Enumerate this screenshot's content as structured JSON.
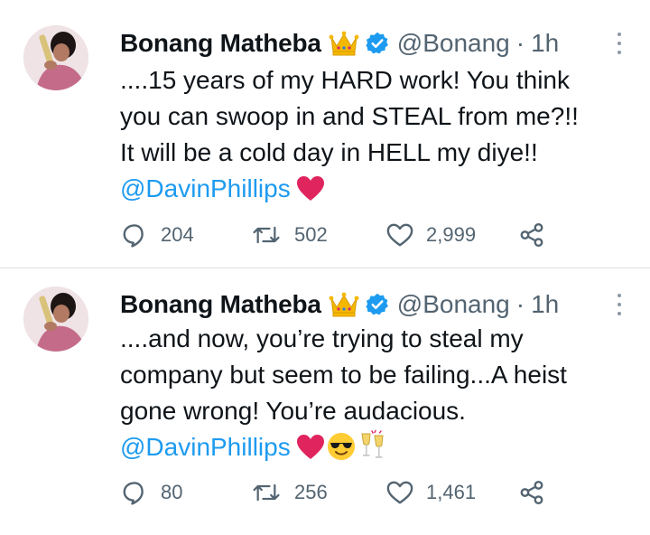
{
  "tweets": [
    {
      "author_name": "Bonang Matheba",
      "handle": "@Bonang",
      "separator": "·",
      "time": "1h",
      "text_lines": [
        "....15 years of my HARD work! You think",
        "you can swoop in and STEAL from me?!!",
        "It will be a cold day in HELL my diye!!"
      ],
      "mention": "@DavinPhillips",
      "emojis": [
        "red-heart"
      ],
      "replies": "204",
      "retweets": "502",
      "likes": "2,999"
    },
    {
      "author_name": "Bonang Matheba",
      "handle": "@Bonang",
      "separator": "·",
      "time": "1h",
      "text_lines": [
        "....and now, you’re trying to steal my",
        "company but seem to be failing...A heist",
        "gone wrong! You’re audacious."
      ],
      "mention": "@DavinPhillips",
      "emojis": [
        "red-heart",
        "sunglasses-face",
        "clinking-glasses"
      ],
      "replies": "80",
      "retweets": "256",
      "likes": "1,461"
    }
  ],
  "icons": {
    "crown": "crown-icon",
    "verified": "verified-badge-icon",
    "more": "more-options-icon",
    "reply": "reply-icon",
    "retweet": "retweet-icon",
    "like": "like-icon",
    "share": "share-icon"
  },
  "colors": {
    "text": "#0f1419",
    "secondary": "#536471",
    "link": "#1d9bf0",
    "verified": "#1d9bf0",
    "heart": "#e0245e",
    "divider": "#dcdfe2"
  }
}
